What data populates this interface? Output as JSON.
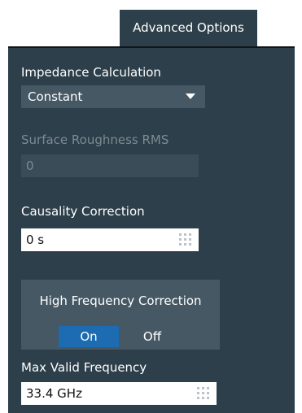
{
  "tab": {
    "label": "Advanced Options"
  },
  "impedance": {
    "label": "Impedance Calculation",
    "value": "Constant"
  },
  "roughness": {
    "label": "Surface Roughness RMS",
    "value": "0"
  },
  "causality": {
    "label": "Causality Correction",
    "value": "0 s"
  },
  "hfc": {
    "label": "High Frequency Correction",
    "on_label": "On",
    "off_label": "Off",
    "selected": "On"
  },
  "max_freq": {
    "label": "Max Valid Frequency",
    "value": "33.4 GHz"
  },
  "colors": {
    "panel": "#2d3f4a",
    "control": "#465864",
    "accent": "#1d6bb0",
    "disabled_text": "#7c8a93"
  }
}
